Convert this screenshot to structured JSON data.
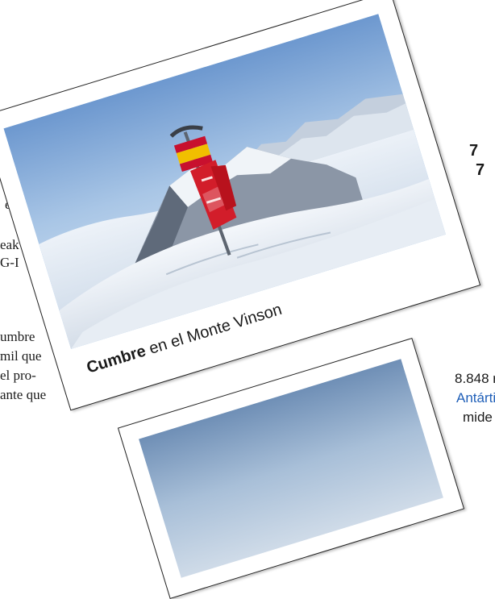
{
  "left_column": {
    "line1": "e",
    "line2": "eak",
    "line3": "G-I",
    "line4": "umbre",
    "line5": "mil que",
    "line6": "el pro-",
    "line7": "ante que"
  },
  "right_column": {
    "num1": "7",
    "num2": "7",
    "line_a": "8.848 r",
    "line_b": "Antártic",
    "line_c": "mide"
  },
  "photo1": {
    "caption_bold": "Cumbre",
    "caption_rest": " en el Monte Vinson"
  },
  "colors": {
    "accent_blue": "#1f5fb8",
    "flag_red": "#c8102e",
    "flag_yellow": "#f1bf00"
  }
}
